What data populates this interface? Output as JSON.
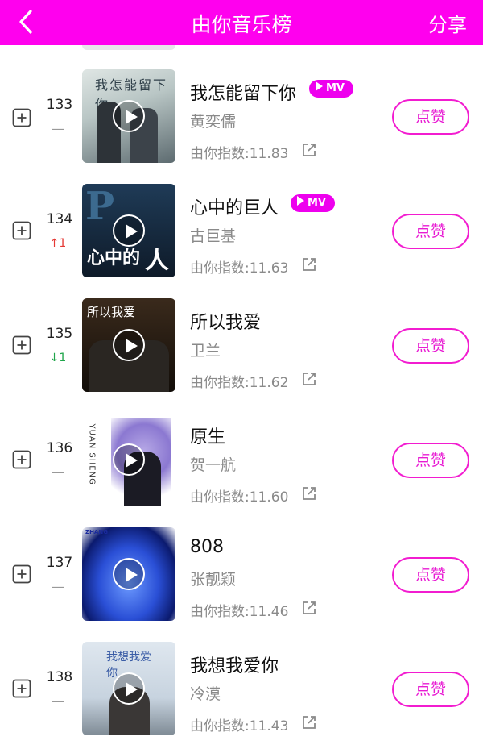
{
  "header": {
    "title": "由你音乐榜",
    "share_label": "分享",
    "background_color": "#ff00ee"
  },
  "icons": {
    "back": "chevron-left-icon",
    "add": "plus-square-icon",
    "share": "share-out-icon",
    "play": "play-circle-icon"
  },
  "rows": [
    {
      "rank": "133",
      "trend": "—",
      "trend_dir": "flat",
      "song": "我怎能留下你",
      "mv": "MV",
      "artist": "黄奕儒",
      "index_label": "由你指数:",
      "index_value": "11.83",
      "like_label": "点赞",
      "cover_text": "我怎能留下你"
    },
    {
      "rank": "134",
      "trend": "↑1",
      "trend_dir": "up",
      "song": "心中的巨人",
      "mv": "MV",
      "artist": "古巨基",
      "index_label": "由你指数:",
      "index_value": "11.63",
      "like_label": "点赞",
      "cover_text": "心中的"
    },
    {
      "rank": "135",
      "trend": "↓1",
      "trend_dir": "down",
      "song": "所以我爱",
      "mv": "",
      "artist": "卫兰",
      "index_label": "由你指数:",
      "index_value": "11.62",
      "like_label": "点赞",
      "cover_text": "所以我爱"
    },
    {
      "rank": "136",
      "trend": "—",
      "trend_dir": "flat",
      "song": "原生",
      "mv": "",
      "artist": "贺一航",
      "index_label": "由你指数:",
      "index_value": "11.60",
      "like_label": "点赞",
      "cover_text": "YUAN SHENG"
    },
    {
      "rank": "137",
      "trend": "—",
      "trend_dir": "flat",
      "song": "808",
      "mv": "",
      "artist": "张靓颖",
      "index_label": "由你指数:",
      "index_value": "11.46",
      "like_label": "点赞",
      "cover_text": "ZHANG"
    },
    {
      "rank": "138",
      "trend": "—",
      "trend_dir": "flat",
      "song": "我想我爱你",
      "mv": "",
      "artist": "冷漠",
      "index_label": "由你指数:",
      "index_value": "11.43",
      "like_label": "点赞",
      "cover_text": "我想我爱你"
    }
  ],
  "colors": {
    "accent": "#f21cd0",
    "trend_up": "#e53935",
    "trend_down": "#1fa54a"
  }
}
